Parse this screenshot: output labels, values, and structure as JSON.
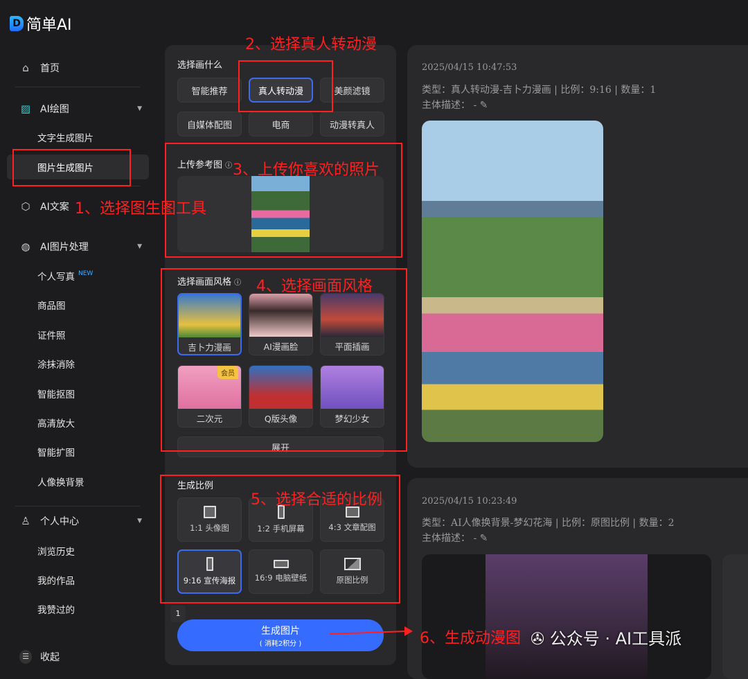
{
  "app": {
    "logo_letter": "D",
    "name": "简单AI"
  },
  "sidebar": {
    "home": "首页",
    "ai_draw": "AI绘图",
    "text_to_image": "文字生成图片",
    "image_to_image": "图片生成图片",
    "ai_copy": "AI文案",
    "ai_image_proc": "AI图片处理",
    "proc_items": [
      "个人写真",
      "商品图",
      "证件照",
      "涂抹消除",
      "智能抠图",
      "高清放大",
      "智能扩图",
      "人像换背景"
    ],
    "new_badge": "NEW",
    "personal": "个人中心",
    "history": "浏览历史",
    "works": "我的作品",
    "liked": "我赞过的",
    "collapse": "收起"
  },
  "panel": {
    "what_label": "选择画什么",
    "what_options": [
      "智能推荐",
      "真人转动漫",
      "美颜滤镜",
      "自媒体配图",
      "电商",
      "动漫转真人"
    ],
    "upload_label": "上传参考图",
    "style_label": "选择画面风格",
    "styles": [
      "吉卜力漫画",
      "AI漫画脸",
      "平面插画",
      "二次元",
      "Q版头像",
      "梦幻少女"
    ],
    "vip_badge": "会员",
    "expand": "展开",
    "ratio_label": "生成比例",
    "ratios": [
      "1:1 头像图",
      "1:2 手机屏幕",
      "4:3 文章配图",
      "9:16 宣传海报",
      "16:9 电脑壁纸",
      "原图比例"
    ],
    "count": "1",
    "generate": "生成图片",
    "generate_cost": "( 消耗2积分 )"
  },
  "results": [
    {
      "time": "2025/04/15 10:47:53",
      "type": "类型：真人转动漫-吉卜力漫画 | 比例：9:16 | 数量：1",
      "desc": "主体描述： -"
    },
    {
      "time": "2025/04/15 10:23:49",
      "type": "类型：AI人像换背景-梦幻花海 | 比例：原图比例 | 数量：2",
      "desc": "主体描述： -"
    }
  ],
  "annotations": [
    "1、选择图生图工具",
    "2、选择真人转动漫",
    "3、上传你喜欢的照片",
    "4、选择画面风格",
    "5、选择合适的比例",
    "6、生成动漫图"
  ],
  "watermark": "公众号 · AI工具派"
}
